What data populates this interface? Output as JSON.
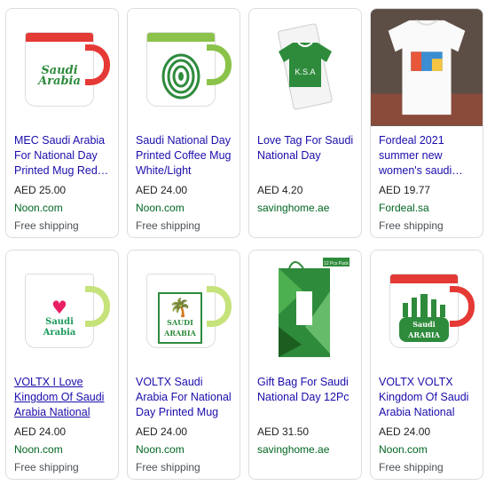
{
  "products": [
    {
      "title": "MEC Saudi Arabia For National Day Printed Mug Red…",
      "price": "AED 25.00",
      "merchant": "Noon.com",
      "shipping": "Free shipping",
      "image_label": "Saudi Arabia"
    },
    {
      "title": "Saudi National Day Printed Coffee Mug White/Light Green…",
      "price": "AED 24.00",
      "merchant": "Noon.com",
      "shipping": "Free shipping",
      "image_label": ""
    },
    {
      "title": "Love Tag For Saudi National Day",
      "price": "AED 4.20",
      "merchant": "savinghome.ae",
      "shipping": "",
      "image_label": "K.S.A"
    },
    {
      "title": "Fordeal 2021 summer new women's saudi…",
      "price": "AED 19.77",
      "merchant": "Fordeal.sa",
      "shipping": "Free shipping",
      "image_label": ""
    },
    {
      "title": "VOLTX I Love Kingdom Of Saudi Arabia National Da…",
      "price": "AED 24.00",
      "merchant": "Noon.com",
      "shipping": "Free shipping",
      "image_label": "Saudi Arabia"
    },
    {
      "title": "VOLTX Saudi Arabia For National Day Printed Mug Gree…",
      "price": "AED 24.00",
      "merchant": "Noon.com",
      "shipping": "Free shipping",
      "image_label": "SAUDI ARABIA"
    },
    {
      "title": "Gift Bag For Saudi National Day 12Pc",
      "price": "AED 31.50",
      "merchant": "savinghome.ae",
      "shipping": "",
      "image_label": "12 Pcs Pack"
    },
    {
      "title": "VOLTX VOLTX Kingdom Of Saudi Arabia National Da…",
      "price": "AED 24.00",
      "merchant": "Noon.com",
      "shipping": "Free shipping",
      "image_label": "Saudi ARABIA"
    }
  ],
  "colors": {
    "red_accent": "#e53935",
    "green_accent": "#8bc34a",
    "dark_green": "#2e8b3c",
    "link": "#1a0dab",
    "merchant": "#006621"
  }
}
